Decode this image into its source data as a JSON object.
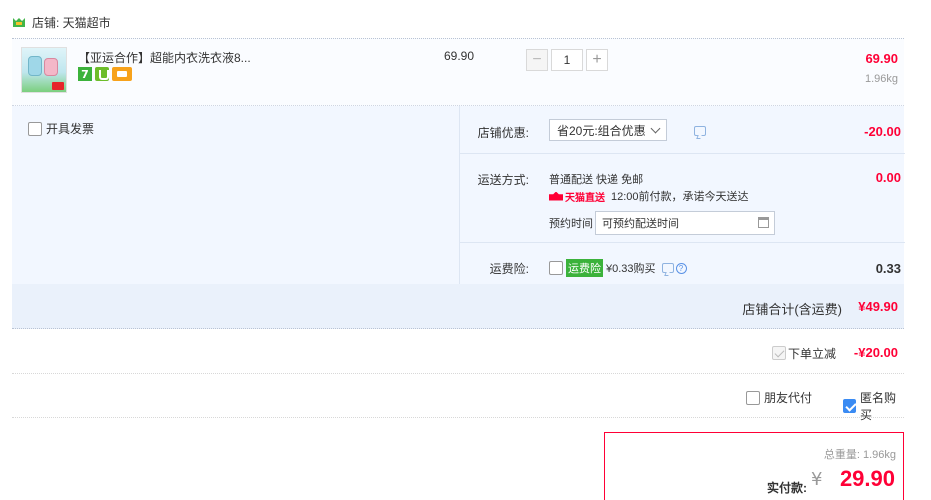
{
  "shop": {
    "label": "店铺: 天猫超市",
    "icon": "tmall-shop-icon"
  },
  "item": {
    "title": "【亚运合作】超能内衣洗衣液8...",
    "unit_price": "69.90",
    "quantity": "1",
    "minus_label": "−",
    "plus_label": "+",
    "line_total": "69.90",
    "weight": "1.96kg",
    "badge_seven": "7"
  },
  "invoice": {
    "label": "开具发票",
    "checked": false
  },
  "shop_discount": {
    "label": "店铺优惠:",
    "selected": "省20元:组合优惠",
    "amount": "-20.00"
  },
  "shipping": {
    "label": "运送方式:",
    "method": "普通配送 快递 免邮",
    "tmall_direct": "天猫直送",
    "promise": "12:00前付款，承诺今天送达",
    "schedule_label": "预约时间",
    "schedule_value": "可预约配送时间",
    "amount": "0.00"
  },
  "insurance": {
    "label": "运费险:",
    "badge": "运费险",
    "price_text": "¥0.33购买",
    "amount": "0.33"
  },
  "subtotal": {
    "label": "店铺合计(含运费)",
    "amount": "¥49.90"
  },
  "order_discount": {
    "label": "下单立减",
    "amount": "-¥20.00"
  },
  "options": {
    "friend_pay": {
      "label": "朋友代付",
      "checked": false
    },
    "anonymous": {
      "label": "匿名购买",
      "checked": true
    }
  },
  "payment": {
    "total_weight": "总重量: 1.96kg",
    "pay_label": "实付款:",
    "currency": "¥",
    "amount": "29.90"
  },
  "colors": {
    "accent_red": "#ff0036",
    "panel_blue": "#f2f7ff",
    "check_blue": "#3a8bf3",
    "badge_green": "#3bb23b"
  }
}
